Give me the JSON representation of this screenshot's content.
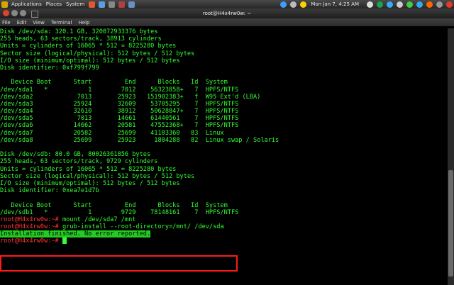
{
  "panel": {
    "menus": [
      "Applications",
      "Places",
      "System"
    ],
    "clock": "Mon Jan 7,  4:25 AM"
  },
  "window": {
    "title": "root@H4x4rw0w: ~"
  },
  "menubar": [
    "File",
    "Edit",
    "View",
    "Terminal",
    "Help"
  ],
  "terminal": {
    "lines": [
      "Disk /dev/sda: 320.1 GB, 320072933376 bytes",
      "255 heads, 63 sectors/track, 38913 cylinders",
      "Units = cylinders of 16065 * 512 = 8225280 bytes",
      "Sector size (logical/physical): 512 bytes / 512 bytes",
      "I/O size (minimum/optimal): 512 bytes / 512 bytes",
      "Disk identifier: 0xf799f799",
      "",
      "   Device Boot      Start         End      Blocks   Id  System",
      "/dev/sda1   *           1        7012    56323858+   7  HPFS/NTFS",
      "/dev/sda2            7013       25923   151902383+   f  W95 Ext'd (LBA)",
      "/dev/sda3           25924       32609    53705295    7  HPFS/NTFS",
      "/dev/sda4           32610       38912    50628847+   7  HPFS/NTFS",
      "/dev/sda5            7013       14661    61440561    7  HPFS/NTFS",
      "/dev/sda6           14662       20581    47552368+   7  HPFS/NTFS",
      "/dev/sda7           20582       25699    41103360   83  Linux",
      "/dev/sda8           25699       25923     1804288   82  Linux swap / Solaris",
      "",
      "Disk /dev/sdb: 80.0 GB, 80026361856 bytes",
      "255 heads, 63 sectors/track, 9729 cylinders",
      "Units = cylinders of 16065 * 512 = 8225280 bytes",
      "Sector size (logical/physical): 512 bytes / 512 bytes",
      "I/O size (minimum/optimal): 512 bytes / 512 bytes",
      "Disk identifier: 0xea7e1d7b",
      "",
      "   Device Boot      Start         End      Blocks   Id  System",
      "/dev/sdb1   *           1        9729    78148161    7  HPFS/NTFS"
    ],
    "prompt": "root@H4x4rw0w:~#",
    "commands": [
      " mount /dev/sda7 /mnt",
      " grub-install --root-directory=/mnt/ /dev/sda"
    ],
    "success_message": "Installation finished. No error reported."
  },
  "colors": {
    "terminal_text": "#33ff33",
    "prompt": "#ff3333",
    "annotation_box": "#ff1a1a"
  }
}
